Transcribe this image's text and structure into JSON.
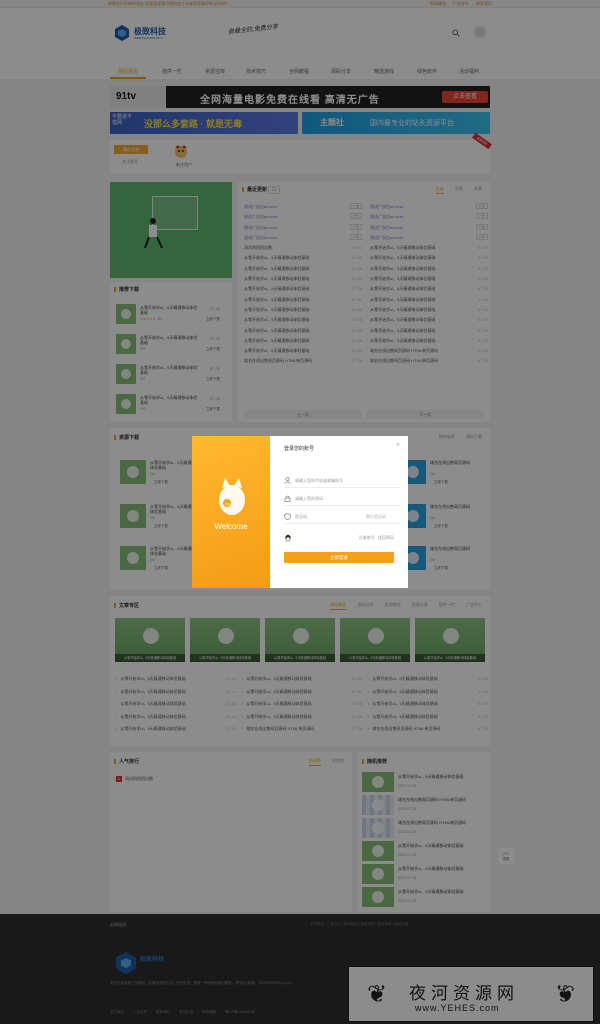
{
  "topbar": {
    "notice": "致敬各行不懈的朋友,发掘温暖潮讯晒挑战工作者我是最好的,好好的!",
    "links": [
      "投稿赚钱",
      "广告合作",
      "联系我们"
    ]
  },
  "header": {
    "logo_name": "极致科技",
    "logo_sub": "WEB TECHNOLOGY",
    "slogan": "做最全的,免费分享"
  },
  "nav": {
    "items": [
      "网站首页",
      "插件一栏",
      "资源宝库",
      "技术技巧",
      "全网教程",
      "源码分享",
      "精选游戏",
      "绿色软件",
      "活动福利"
    ],
    "active": 0
  },
  "banners": {
    "b1_logo": "91tv",
    "b1_text": "全网海量电影免费在线看 高清无广告",
    "b1_btn": "点击查看",
    "b2_t1": "不要进不错网",
    "b2_t2": "没那么多套路 · 就是无毒",
    "b3_t1": "主题社",
    "b3_t2": "国内最专业的站长资源平台"
  },
  "auth": {
    "tab_active": "最近注册",
    "tab_other": "关注推荐",
    "user": "新注用户",
    "corner": "最新成员"
  },
  "recommend": {
    "title": "推荐下载",
    "items": [
      {
        "title": "从零开始学ui，5天精通移动体验基础",
        "date": "07-25",
        "meta": "2M",
        "rating": "★★★★★",
        "dl": "立即下载"
      },
      {
        "title": "从零开始学ui，5天精通移动体验基础",
        "date": "07-25",
        "meta": "2M",
        "dl": "立即下载"
      },
      {
        "title": "从零开始学ui，5天精通移动体验基础",
        "date": "07-25",
        "meta": "2M",
        "dl": "立即下载"
      },
      {
        "title": "从零开始学ui，5天精通移动体验基础",
        "date": "07-25",
        "meta": "2M",
        "dl": "立即下载"
      }
    ]
  },
  "news": {
    "title": "最近更新",
    "count": "11",
    "tabs": [
      "全部",
      "资源",
      "文章"
    ],
    "left": [
      {
        "t": "测试广告位url.com",
        "ad": "广告",
        "link": true
      },
      {
        "t": "测试广告位url.com",
        "ad": "广告",
        "link": true
      },
      {
        "t": "测试广告位url.com",
        "ad": "广告",
        "link": true
      },
      {
        "t": "测试广告位url.com",
        "ad": "广告",
        "link": true
      },
      {
        "t": "测试的招招出数",
        "d": "07-31"
      },
      {
        "t": "从零开始学ui，5天精通移动体验基础",
        "d": "07-25"
      },
      {
        "t": "从零开始学ui，5天精通移动体验基础",
        "d": "07-25"
      },
      {
        "t": "从零开始学ui，5天精通移动体验基础",
        "d": "07-25"
      },
      {
        "t": "从零开始学ui，5天精通移动体验基础",
        "d": "07-25"
      },
      {
        "t": "从零开始学ui，5天精通移动体验基础",
        "d": "07-25"
      },
      {
        "t": "从零开始学ui，5天精通移动体验基础",
        "d": "07-25"
      },
      {
        "t": "从零开始学ui，5天精通移动体验基础",
        "d": "07-25"
      },
      {
        "t": "从零开始学ui，5天精通移动体验基础",
        "d": "07-25"
      },
      {
        "t": "从零开始学ui，5天精通移动体验基础",
        "d": "07-25"
      },
      {
        "t": "从零开始学ui，5天精通移动体验基础",
        "d": "07-25"
      },
      {
        "t": "域名在线出售网页源码 HTML单页源码",
        "d": "07-25"
      }
    ],
    "right": [
      {
        "t": "测试广告位url.com",
        "ad": "广告",
        "link": true
      },
      {
        "t": "测试广告位url.com",
        "ad": "广告",
        "link": true
      },
      {
        "t": "测试广告位url.com",
        "ad": "广告",
        "link": true
      },
      {
        "t": "测试广告位url.com",
        "ad": "广告",
        "link": true
      },
      {
        "t": "从零开始学ui，5天精通移动体验基础",
        "d": "07-25"
      },
      {
        "t": "从零开始学ui，5天精通移动体验基础",
        "d": "07-25"
      },
      {
        "t": "从零开始学ui，5天精通移动体验基础",
        "d": "07-25"
      },
      {
        "t": "从零开始学ui，5天精通移动体验基础",
        "d": "07-25"
      },
      {
        "t": "从零开始学ui，5天精通移动体验基础",
        "d": "07-25"
      },
      {
        "t": "从零开始学ui，5天精通移动体验基础",
        "d": "07-25"
      },
      {
        "t": "从零开始学ui，5天精通移动体验基础",
        "d": "07-25"
      },
      {
        "t": "从零开始学ui，5天精通移动体验基础",
        "d": "07-25"
      },
      {
        "t": "从零开始学ui，5天精通移动体验基础",
        "d": "07-25"
      },
      {
        "t": "从零开始学ui，5天精通移动体验基础",
        "d": "07-25"
      },
      {
        "t": "域名在线出售网页源码 HTML单页源码",
        "d": "07-25"
      },
      {
        "t": "域名在线出售网页源码 HTML单页源码",
        "d": "07-25"
      }
    ],
    "prev": "上一页",
    "next": "下一页"
  },
  "resources": {
    "title": "资源下载",
    "tabs": [
      "插件推荐",
      "源码下载"
    ],
    "items": [
      {
        "title": "从零开始学ui，5天精通移动体验基础",
        "meta": "2M",
        "dl": "立即下载"
      },
      {
        "title": "从零开始学ui，5天精通移动体验基础",
        "meta": "2M",
        "dl": "立即下载"
      },
      {
        "title": "从零开始学ui，5天精通移动体验基础",
        "meta": "2M",
        "dl": "立即下载"
      },
      {
        "title": "域名在线出售网页源码",
        "meta": "2M",
        "dl": "立即下载"
      },
      {
        "title": "域名在线出售网页源码",
        "meta": "2M",
        "dl": "立即下载"
      },
      {
        "title": "域名在线出售网页源码",
        "meta": "2M",
        "dl": "立即下载"
      }
    ]
  },
  "articles": {
    "title": "文章专区",
    "tabs": [
      "网站建设",
      "源码分享",
      "实用教程",
      "资源分享",
      "插件一栏",
      "广告中心"
    ],
    "thumb_label": "从零开始学ui，5天精通移动体验基础",
    "cols": [
      [
        {
          "t": "从零开始学ui，5天精通移动体验基础",
          "d": "07-25"
        },
        {
          "t": "从零开始学ui，5天精通移动体验基础",
          "d": "07-25"
        },
        {
          "t": "从零开始学ui，5天精通移动体验基础",
          "d": "07-25"
        },
        {
          "t": "从零开始学ui，5天精通移动体验基础",
          "d": "07-25"
        },
        {
          "t": "从零开始学ui，5天精通移动体验基础",
          "d": "07-25"
        }
      ],
      [
        {
          "t": "从零开始学ui，5天精通移动体验基础",
          "d": "07-25"
        },
        {
          "t": "从零开始学ui，5天精通移动体验基础",
          "d": "07-25"
        },
        {
          "t": "从零开始学ui，5天精通移动体验基础",
          "d": "07-25"
        },
        {
          "t": "从零开始学ui，5天精通移动体验基础",
          "d": "07-25"
        },
        {
          "t": "域名在线出售网页源码 HTML单页源码",
          "d": "07-25"
        }
      ],
      [
        {
          "t": "从零开始学ui，5天精通移动体验基础",
          "d": "07-25"
        },
        {
          "t": "从零开始学ui，5天精通移动体验基础",
          "d": "07-25"
        },
        {
          "t": "从零开始学ui，5天精通移动体验基础",
          "d": "07-25"
        },
        {
          "t": "从零开始学ui，5天精通移动体验基础",
          "d": "07-25"
        },
        {
          "t": "域名在线出售网页源码 HTML单页源码",
          "d": "07-25"
        }
      ]
    ]
  },
  "hot": {
    "title": "人气排行",
    "tabs": [
      "热评榜",
      "浏览榜"
    ],
    "item": "测试的招招出数"
  },
  "random": {
    "title": "随机推荐",
    "items": [
      {
        "t": "从零开始学ui，5天精通移动体验基础",
        "d": "2020-07-25"
      },
      {
        "t": "域名在线出售网页源码 HTML单页源码",
        "d": "2020-07-25"
      },
      {
        "t": "域名在线出售网页源码 HTML单页源码",
        "d": "2020-07-25"
      },
      {
        "t": "从零开始学ui，5天精通移动体验基础",
        "d": "2020-07-25"
      },
      {
        "t": "从零开始学ui，5天精通移动体验基础",
        "d": "2020-07-25"
      },
      {
        "t": "从零开始学ui，5天精通移动体验基础",
        "d": "2020-07-25"
      }
    ]
  },
  "backtop": "顶部",
  "footer": {
    "friend": "友情链接",
    "links": "关于网站 | 广告合作 | 联系我们 | 投稿说明 | 免责声明 | 网站地图",
    "logo": "极致科技",
    "desc": "本站内容来源于互联网，如果有侵权内容 / 不良信息，请第一时间联系我们删除。联系QQ邮箱：",
    "email": "999000000@qq.com",
    "nav": [
      "关于我们",
      "广告合作",
      "联系我们",
      "意见反馈",
      "网站地图",
      "鄂ICP备1800000号"
    ]
  },
  "watermark": {
    "cn": "夜河资源网",
    "url": "www.YEHES.com"
  },
  "modal": {
    "title": "登录您的账号",
    "phone_ph": "请输入您的手机或邮箱账号",
    "pwd_ph": "请输入您的密码",
    "code_ph": "验证码",
    "code_btn": "图片验证码",
    "welcome": "Welcome",
    "register": "注册账号",
    "forgot": "找回密码",
    "login": "立即登录",
    "close": "×"
  },
  "colors": {
    "accent": "#e8a62a",
    "modal": "#f6a01a",
    "hero": "#5fb86f"
  }
}
